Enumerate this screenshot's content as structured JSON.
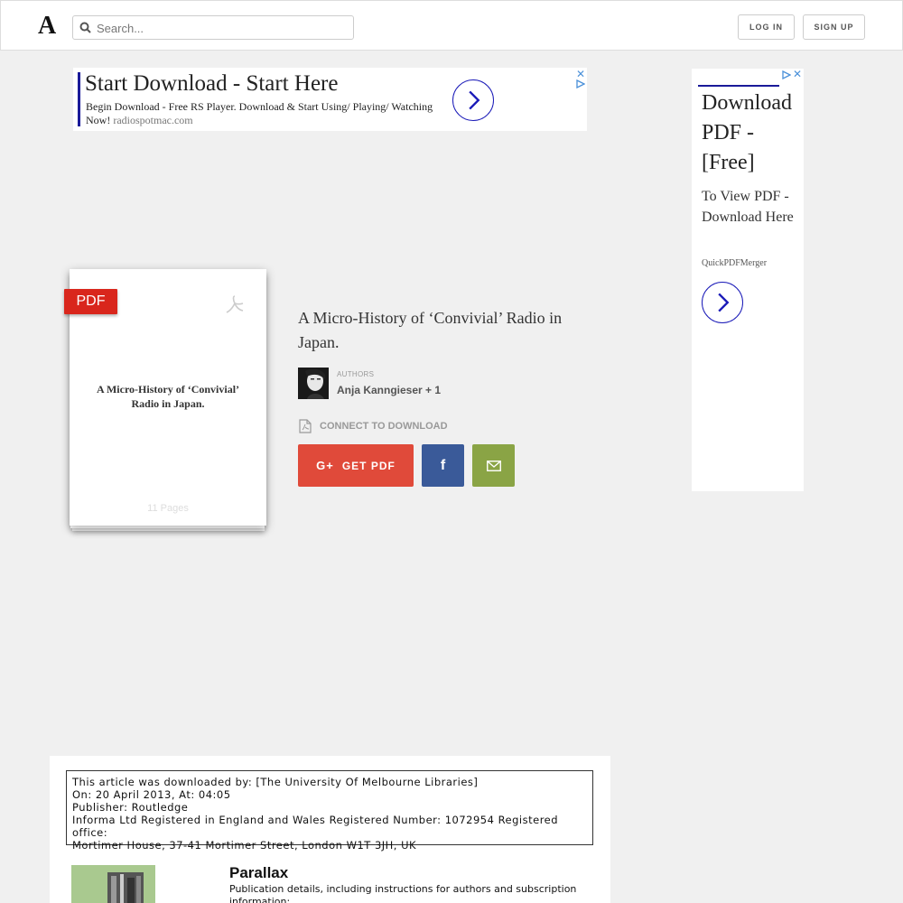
{
  "header": {
    "logo": "A",
    "search_placeholder": "Search...",
    "login_label": "LOG IN",
    "signup_label": "SIGN UP"
  },
  "ad_top": {
    "title": "Start Download - Start Here",
    "description": "Begin Download - Free RS Player. Download & Start Using/ Playing/ Watching Now!",
    "site": "radiospotmac.com"
  },
  "ad_side": {
    "title": "Download PDF - [Free]",
    "description": "To View PDF - Download Here",
    "site": "QuickPDFMerger"
  },
  "document": {
    "badge": "PDF",
    "thumb_title": "A Micro-History of ‘Convivial’ Radio in Japan.",
    "pages": "11 Pages",
    "title": "A Micro-History of ‘Convivial’ Radio in Japan.",
    "authors_label": "AUTHORS",
    "authors": "Anja Kanngieser + 1",
    "connect_label": "CONNECT TO DOWNLOAD",
    "get_pdf_label": "GET PDF",
    "gplus_glyph": "G+",
    "facebook_glyph": "f"
  },
  "preview": {
    "notice_lines": [
      "This article was downloaded by: [The University Of Melbourne Libraries]",
      "On: 20 April 2013, At: 04:05",
      "Publisher: Routledge",
      "Informa Ltd Registered in England and Wales Registered Number: 1072954 Registered office:",
      "Mortimer House, 37-41 Mortimer Street, London W1T 3JH, UK"
    ],
    "journal_title": "Parallax",
    "journal_desc": "Publication details, including instructions for authors and subscription information:"
  },
  "colors": {
    "pdf_badge": "#d9261c",
    "get_pdf": "#e04a3a",
    "facebook": "#3a5a99",
    "email": "#8aa445",
    "ad_accent": "#1a1ab8"
  }
}
